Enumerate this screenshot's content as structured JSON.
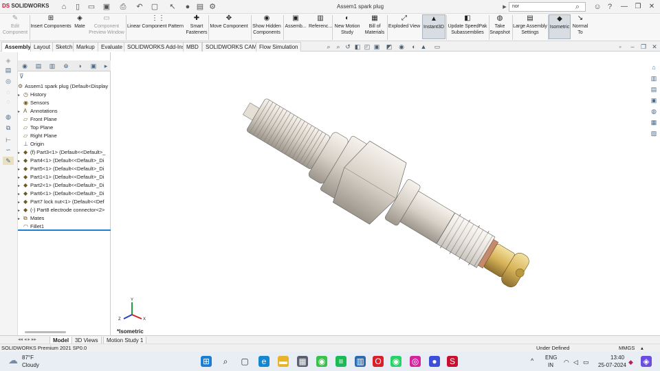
{
  "app": {
    "logo_text": "SOLIDWORKS",
    "window_title": "Assem1 spark plug"
  },
  "search": {
    "value": "nor"
  },
  "ribbon": [
    {
      "icon": "edit-component-icon",
      "l1": "Edit",
      "l2": "Component",
      "disabled": true
    },
    {
      "icon": "insert-components-icon",
      "l1": "Insert Components",
      "l2": ""
    },
    {
      "icon": "mate-icon",
      "l1": "Mate",
      "l2": ""
    },
    {
      "icon": "component-preview-icon",
      "l1": "Component",
      "l2": "Preview Window",
      "disabled": true
    },
    {
      "icon": "linear-pattern-icon",
      "l1": "Linear Component Pattern",
      "l2": ""
    },
    {
      "icon": "smart-fasteners-icon",
      "l1": "Smart",
      "l2": "Fasteners"
    },
    {
      "icon": "move-component-icon",
      "l1": "Move Component",
      "l2": ""
    },
    {
      "icon": "show-hidden-icon",
      "l1": "Show Hidden",
      "l2": "Components"
    },
    {
      "icon": "assembly-features-icon",
      "l1": "Assemb...",
      "l2": ""
    },
    {
      "icon": "reference-geometry-icon",
      "l1": "Referenc...",
      "l2": ""
    },
    {
      "icon": "new-motion-study-icon",
      "l1": "New Motion",
      "l2": "Study"
    },
    {
      "icon": "bill-of-materials-icon",
      "l1": "Bill of",
      "l2": "Materials"
    },
    {
      "icon": "exploded-view-icon",
      "l1": "Exploded View",
      "l2": ""
    },
    {
      "icon": "instant3d-icon",
      "l1": "Instant3D",
      "l2": "",
      "active": true
    },
    {
      "icon": "update-speedpak-icon",
      "l1": "Update SpeedPak",
      "l2": "Subassemblies"
    },
    {
      "icon": "take-snapshot-icon",
      "l1": "Take",
      "l2": "Snapshot"
    },
    {
      "icon": "large-assembly-icon",
      "l1": "Large Assembly",
      "l2": "Settings"
    },
    {
      "icon": "isometric-icon",
      "l1": "Isometric",
      "l2": "",
      "active": true
    },
    {
      "icon": "normal-to-icon",
      "l1": "Normal",
      "l2": "To"
    }
  ],
  "tabs": [
    "Assembly",
    "Layout",
    "Sketch",
    "Markup",
    "Evaluate",
    "SOLIDWORKS Add-Ins",
    "MBD",
    "SOLIDWORKS CAM",
    "Flow Simulation"
  ],
  "tree": {
    "root": "Assem1 spark plug  (Default<Display",
    "nodes": [
      {
        "label": "History",
        "arrow": true,
        "icon": "history-icon"
      },
      {
        "label": "Sensors",
        "arrow": false,
        "icon": "sensors-icon"
      },
      {
        "label": "Annotations",
        "arrow": true,
        "icon": "annotations-icon"
      },
      {
        "label": "Front Plane",
        "arrow": false,
        "icon": "plane-icon"
      },
      {
        "label": "Top Plane",
        "arrow": false,
        "icon": "plane-icon"
      },
      {
        "label": "Right Plane",
        "arrow": false,
        "icon": "plane-icon"
      },
      {
        "label": "Origin",
        "arrow": false,
        "icon": "origin-icon"
      },
      {
        "label": "(f) Part3<1> (Default<<Default>_",
        "arrow": true,
        "icon": "part-icon"
      },
      {
        "label": "Part4<1> (Default<<Default>_Di",
        "arrow": true,
        "icon": "part-icon"
      },
      {
        "label": "Part5<1> (Default<<Default>_Di",
        "arrow": true,
        "icon": "part-icon"
      },
      {
        "label": "Part1<1> (Default<<Default>_Di",
        "arrow": true,
        "icon": "part-icon"
      },
      {
        "label": "Part2<1> (Default<<Default>_Di",
        "arrow": true,
        "icon": "part-icon"
      },
      {
        "label": "Part6<1> (Default<<Default>_Di",
        "arrow": true,
        "icon": "part-icon"
      },
      {
        "label": "Part7 lock nut<1> (Default<<Def",
        "arrow": true,
        "icon": "part-icon"
      },
      {
        "label": "(-) Part8 electrode connector<2>",
        "arrow": true,
        "icon": "part-icon"
      },
      {
        "label": "Mates",
        "arrow": true,
        "icon": "mates-icon"
      },
      {
        "label": "Fillet1",
        "arrow": false,
        "icon": "fillet-icon"
      }
    ]
  },
  "viewport": {
    "view_label": "*Isometric",
    "axis_x": "X",
    "axis_y": "Y",
    "axis_z": "Z"
  },
  "bottom_tabs": [
    "Model",
    "3D Views",
    "Motion Study 1"
  ],
  "status": {
    "left": "SOLIDWORKS Premium 2021 SP0.0",
    "defined": "Under Defined",
    "units": "MMGS"
  },
  "taskbar": {
    "weather_temp": "87°F",
    "weather_desc": "Cloudy",
    "lang1": "ENG",
    "lang2": "IN",
    "time": "13:40",
    "date": "25-07-2024"
  },
  "colors": {
    "brand": "#c8102e",
    "accent": "#1a7fd4"
  }
}
